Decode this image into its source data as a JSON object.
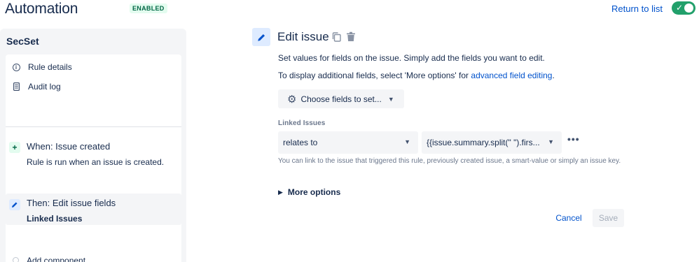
{
  "header": {
    "title": "Automation",
    "status_badge": "ENABLED",
    "return_link": "Return to list",
    "toggle_on": true,
    "toggle_color": "#22a06b"
  },
  "sidebar": {
    "rule_name": "SecSet",
    "menu": [
      {
        "label": "Rule details",
        "icon": "info-icon"
      },
      {
        "label": "Audit log",
        "icon": "document-icon"
      }
    ],
    "trigger": {
      "title": "When: Issue created",
      "description": "Rule is run when an issue is created.",
      "icon": "plus-icon"
    },
    "action": {
      "title": "Then: Edit issue fields",
      "description": "Linked Issues",
      "icon": "pencil-icon"
    },
    "add_component": "Add component"
  },
  "main": {
    "title": "Edit issue",
    "description": "Set values for fields on the issue. Simply add the fields you want to edit.",
    "additional_prefix": "To display additional fields, select 'More options' for ",
    "additional_link": "advanced field editing",
    "additional_suffix": ".",
    "choose_fields_label": "Choose fields to set...",
    "field": {
      "label": "Linked Issues",
      "relation_value": "relates to",
      "issue_value": "{{issue.summary.split(\" \").firs...",
      "helper": "You can link to the issue that triggered this rule, previously created issue, a smart-value or simply an issue key."
    },
    "more_options": "More options",
    "cancel_label": "Cancel",
    "save_label": "Save"
  },
  "colors": {
    "link": "#0052cc",
    "text": "#172b4d",
    "badge_bg": "#e3fcef",
    "badge_text": "#006644"
  }
}
